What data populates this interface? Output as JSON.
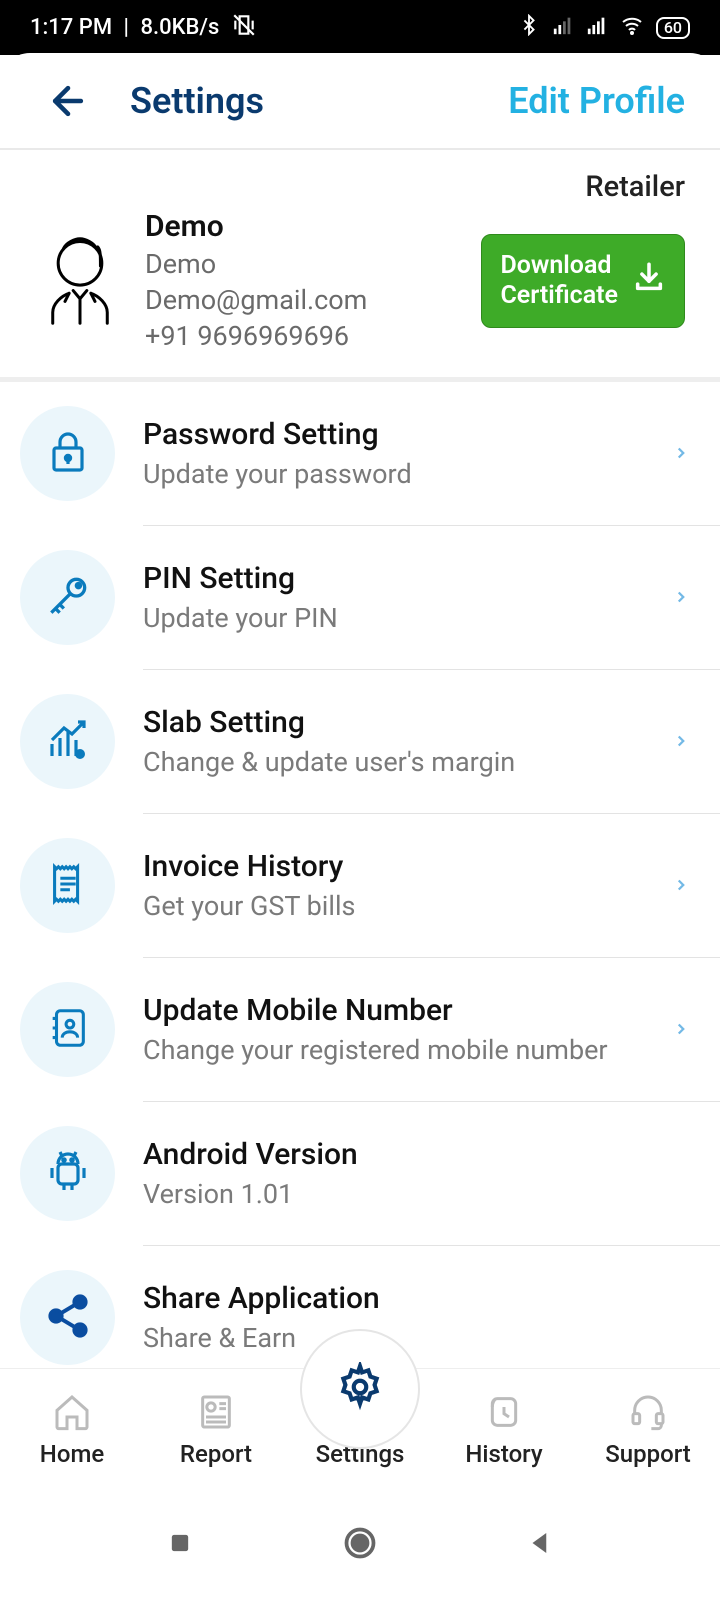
{
  "status": {
    "time": "1:17 PM",
    "net_speed": "8.0KB/s",
    "battery": "60"
  },
  "header": {
    "title": "Settings",
    "edit_profile": "Edit Profile"
  },
  "profile": {
    "role": "Retailer",
    "name": "Demo",
    "company": "Demo",
    "email": "Demo@gmail.com",
    "phone": "+91 9696969696",
    "download_line1": "Download",
    "download_line2": "Certificate"
  },
  "items": [
    {
      "title": "Password Setting",
      "sub": "Update your password",
      "chev": true,
      "icon": "lock"
    },
    {
      "title": "PIN Setting",
      "sub": "Update your PIN",
      "chev": true,
      "icon": "key"
    },
    {
      "title": "Slab Setting",
      "sub": "Change & update user's margin",
      "chev": true,
      "icon": "chart"
    },
    {
      "title": "Invoice History",
      "sub": "Get your GST bills",
      "chev": true,
      "icon": "invoice"
    },
    {
      "title": "Update Mobile Number",
      "sub": "Change your registered mobile number",
      "chev": true,
      "icon": "contact"
    },
    {
      "title": "Android Version",
      "sub": "Version 1.01",
      "chev": false,
      "icon": "android"
    },
    {
      "title": "Share Application",
      "sub": "Share & Earn",
      "chev": false,
      "icon": "share"
    }
  ],
  "nav": {
    "home": "Home",
    "report": "Report",
    "settings": "Settings",
    "history": "History",
    "support": "Support"
  }
}
